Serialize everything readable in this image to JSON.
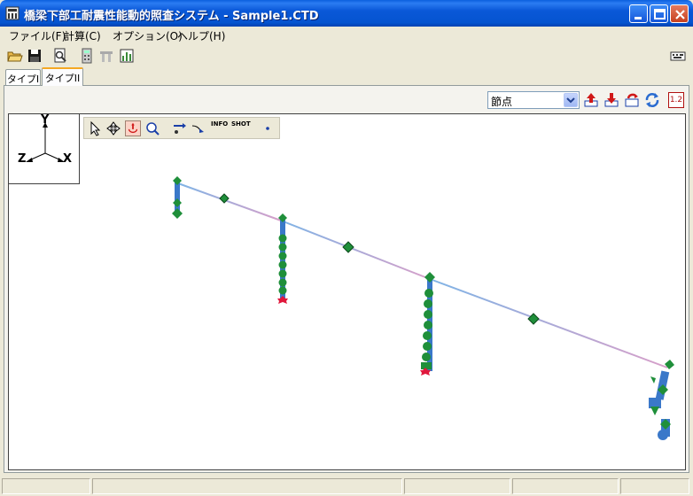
{
  "window": {
    "title": "橋梁下部工耐震性能動的照査システム - Sample1.CTD"
  },
  "menu": {
    "items": [
      {
        "label": "ファイル(F)"
      },
      {
        "label": "計算(C)"
      },
      {
        "label": "オプション(O)"
      },
      {
        "label": "ヘルプ(H)"
      }
    ]
  },
  "toolbar": {
    "icons": [
      "open-folder-icon",
      "save-icon",
      "print-preview-icon",
      "calculator-icon",
      "bridge-icon",
      "chart-icon",
      "keyboard-icon"
    ]
  },
  "tabs": [
    {
      "label": "タイプI"
    },
    {
      "label": "タイプII"
    }
  ],
  "view_controls": {
    "select_value": "節点",
    "icons": [
      "up-arrow-icon",
      "down-arrow-icon",
      "refresh-icon",
      "rotate-icon",
      "scale-icon"
    ],
    "scale_label": "1.2"
  },
  "axes": {
    "y": "Y",
    "z": "Z",
    "x": "X"
  },
  "view_tools": {
    "info_label": "INFO",
    "shot_label": "SHOT"
  },
  "colors": {
    "title_blue": "#0554d0",
    "beam_blue": "#7fb4e6",
    "beam_pink": "#d79fc9",
    "node_green": "#1f8f3a",
    "pier_blue": "#3a78c9",
    "support_red": "#e0183c"
  }
}
